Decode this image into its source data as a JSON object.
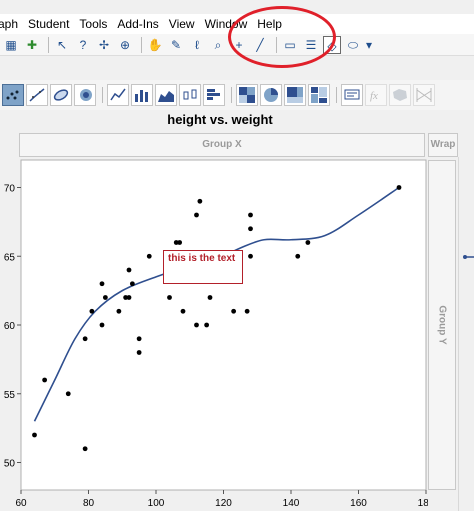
{
  "menubar": {
    "items": [
      "aph",
      "Student",
      "Tools",
      "Add-Ins",
      "View",
      "Window",
      "Help"
    ]
  },
  "toolbar": {
    "tools": [
      "arrow-tool",
      "help-tool",
      "crosshair-tool",
      "target-tool",
      "hand-tool",
      "brush-tool",
      "lasso-tool",
      "zoom-tool",
      "plus-tool",
      "line-tool"
    ],
    "annotate_tools": [
      "annotate-tool",
      "polygon-line-tool",
      "simple-shape-tool",
      "ellipse-tool"
    ]
  },
  "graph_builder": {
    "element_buttons": [
      "points",
      "smoother",
      "ellipse",
      "contour",
      "line",
      "bar",
      "area",
      "box-plot",
      "histogram",
      "heatmap",
      "pie",
      "treemap",
      "mosaic",
      "caption-box",
      "formula",
      "map-shapes",
      "parallel"
    ]
  },
  "graph": {
    "title": "height vs. weight",
    "group_x_label": "Group X",
    "wrap_label": "Wrap",
    "group_y_label": "Group Y",
    "annotation_text": "this is the text",
    "accent_color": "#2f4f8f",
    "annotation_color": "#b3202a",
    "highlight_color": "#e0202a"
  },
  "chart_data": {
    "type": "scatter",
    "title": "height vs. weight",
    "xlim": [
      60,
      180
    ],
    "ylim": [
      48,
      72
    ],
    "x_ticks": [
      "60",
      "80",
      "100",
      "120",
      "140",
      "160",
      "180"
    ],
    "y_ticks": [
      "70",
      "65",
      "60",
      "55",
      "50"
    ],
    "y_tick_values": [
      70,
      65,
      60,
      55,
      50
    ],
    "x_tick_values": [
      60,
      80,
      100,
      120,
      140,
      160,
      180
    ],
    "points": [
      {
        "x": 64,
        "y": 52
      },
      {
        "x": 67,
        "y": 56
      },
      {
        "x": 74,
        "y": 55
      },
      {
        "x": 79,
        "y": 51
      },
      {
        "x": 79,
        "y": 59
      },
      {
        "x": 81,
        "y": 61
      },
      {
        "x": 84,
        "y": 60
      },
      {
        "x": 84,
        "y": 63
      },
      {
        "x": 85,
        "y": 62
      },
      {
        "x": 89,
        "y": 61
      },
      {
        "x": 91,
        "y": 62
      },
      {
        "x": 92,
        "y": 64
      },
      {
        "x": 92,
        "y": 62
      },
      {
        "x": 93,
        "y": 63
      },
      {
        "x": 95,
        "y": 59
      },
      {
        "x": 95,
        "y": 58
      },
      {
        "x": 98,
        "y": 65
      },
      {
        "x": 103,
        "y": 64
      },
      {
        "x": 104,
        "y": 62
      },
      {
        "x": 106,
        "y": 66
      },
      {
        "x": 107,
        "y": 66
      },
      {
        "x": 108,
        "y": 61
      },
      {
        "x": 111,
        "y": 65
      },
      {
        "x": 112,
        "y": 65
      },
      {
        "x": 112,
        "y": 68
      },
      {
        "x": 112,
        "y": 60
      },
      {
        "x": 113,
        "y": 69
      },
      {
        "x": 115,
        "y": 60
      },
      {
        "x": 116,
        "y": 62
      },
      {
        "x": 119,
        "y": 65
      },
      {
        "x": 123,
        "y": 61
      },
      {
        "x": 127,
        "y": 61
      },
      {
        "x": 128,
        "y": 67
      },
      {
        "x": 128,
        "y": 68
      },
      {
        "x": 128,
        "y": 65
      },
      {
        "x": 142,
        "y": 65
      },
      {
        "x": 145,
        "y": 66
      },
      {
        "x": 172,
        "y": 70
      }
    ],
    "smoother": [
      [
        64,
        53
      ],
      [
        70,
        56
      ],
      [
        76,
        59
      ],
      [
        82,
        61
      ],
      [
        90,
        62.5
      ],
      [
        100,
        63.5
      ],
      [
        110,
        64.3
      ],
      [
        118,
        64.8
      ],
      [
        125,
        65.6
      ],
      [
        132,
        66.2
      ],
      [
        140,
        66.2
      ],
      [
        150,
        66.5
      ],
      [
        160,
        68
      ],
      [
        172,
        70
      ]
    ]
  }
}
